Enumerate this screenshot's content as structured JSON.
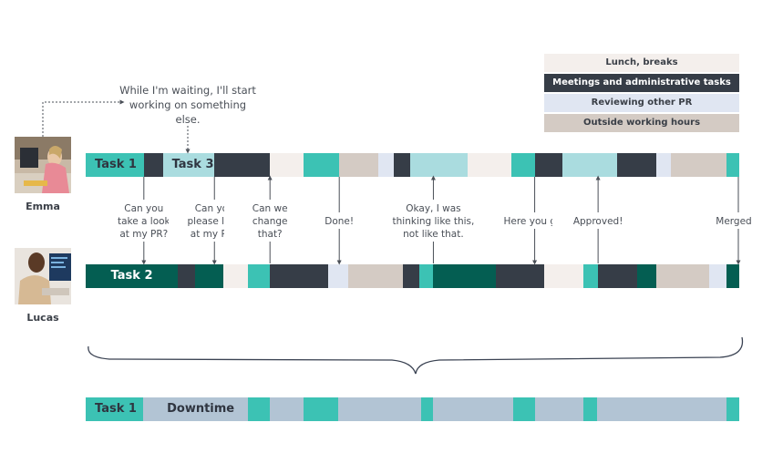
{
  "colors": {
    "teal": "#3cc2b4",
    "light_teal": "#aadcdf",
    "dark_green": "#045e52",
    "dark": "#363d47",
    "cream": "#f4efec",
    "light_blue": "#e0e6f2",
    "taupe": "#d4cbc4",
    "downtime_grey": "#b2c4d4",
    "line": "#4a4f57"
  },
  "legend": [
    {
      "label": "Lunch, breaks",
      "color": "#f4efec",
      "text_color": "#3a3f47"
    },
    {
      "label": "Meetings and administrative tasks",
      "color": "#363d47",
      "text_color": "#ffffff"
    },
    {
      "label": "Reviewing other PR",
      "color": "#e0e6f2",
      "text_color": "#3a3f47"
    },
    {
      "label": "Outside working hours",
      "color": "#d4cbc4",
      "text_color": "#3a3f47"
    }
  ],
  "people": {
    "emma": {
      "name": "Emma"
    },
    "lucas": {
      "name": "Lucas"
    }
  },
  "top_note": "While I'm waiting, I'll start working on something else.",
  "timeline_units": "relative time (0 = start, 100 = end)",
  "rows": {
    "emma": {
      "segments": [
        {
          "start": 0,
          "end": 8.9,
          "type": "teal",
          "label": "Task 1"
        },
        {
          "start": 8.9,
          "end": 11.8,
          "type": "dark"
        },
        {
          "start": 11.8,
          "end": 19.7,
          "type": "light_teal",
          "label": "Task 3"
        },
        {
          "start": 19.7,
          "end": 28.2,
          "type": "dark"
        },
        {
          "start": 28.2,
          "end": 33.4,
          "type": "cream"
        },
        {
          "start": 33.4,
          "end": 38.8,
          "type": "teal"
        },
        {
          "start": 38.8,
          "end": 44.8,
          "type": "taupe"
        },
        {
          "start": 44.8,
          "end": 47.2,
          "type": "light_blue"
        },
        {
          "start": 47.2,
          "end": 49.7,
          "type": "dark"
        },
        {
          "start": 49.7,
          "end": 58.5,
          "type": "light_teal"
        },
        {
          "start": 58.5,
          "end": 65.2,
          "type": "cream"
        },
        {
          "start": 65.2,
          "end": 68.7,
          "type": "teal"
        },
        {
          "start": 68.7,
          "end": 73.0,
          "type": "dark"
        },
        {
          "start": 73.0,
          "end": 81.3,
          "type": "light_teal"
        },
        {
          "start": 81.3,
          "end": 87.3,
          "type": "dark"
        },
        {
          "start": 87.3,
          "end": 89.6,
          "type": "light_blue"
        },
        {
          "start": 89.6,
          "end": 98.0,
          "type": "taupe"
        },
        {
          "start": 98.0,
          "end": 100,
          "type": "teal"
        }
      ]
    },
    "lucas": {
      "segments": [
        {
          "start": 0,
          "end": 14.1,
          "type": "dark_green",
          "label": "Task 2"
        },
        {
          "start": 14.1,
          "end": 16.7,
          "type": "dark"
        },
        {
          "start": 16.7,
          "end": 21.1,
          "type": "dark_green"
        },
        {
          "start": 21.1,
          "end": 24.8,
          "type": "cream"
        },
        {
          "start": 24.8,
          "end": 28.2,
          "type": "teal"
        },
        {
          "start": 28.2,
          "end": 37.1,
          "type": "dark"
        },
        {
          "start": 37.1,
          "end": 40.1,
          "type": "light_blue"
        },
        {
          "start": 40.1,
          "end": 48.6,
          "type": "taupe"
        },
        {
          "start": 48.6,
          "end": 51.1,
          "type": "dark"
        },
        {
          "start": 51.1,
          "end": 53.2,
          "type": "teal"
        },
        {
          "start": 53.2,
          "end": 62.7,
          "type": "dark_green"
        },
        {
          "start": 62.7,
          "end": 70.1,
          "type": "dark"
        },
        {
          "start": 70.1,
          "end": 76.1,
          "type": "cream"
        },
        {
          "start": 76.1,
          "end": 78.4,
          "type": "teal"
        },
        {
          "start": 78.4,
          "end": 84.4,
          "type": "dark"
        },
        {
          "start": 84.4,
          "end": 87.3,
          "type": "dark_green"
        },
        {
          "start": 87.3,
          "end": 95.4,
          "type": "taupe"
        },
        {
          "start": 95.4,
          "end": 98.0,
          "type": "light_blue"
        },
        {
          "start": 98.0,
          "end": 100,
          "type": "dark_green"
        }
      ]
    },
    "downtime": {
      "segments": [
        {
          "start": 0,
          "end": 8.8,
          "type": "teal",
          "label": "Task 1"
        },
        {
          "start": 8.8,
          "end": 24.8,
          "type": "downtime_grey",
          "label": "Downtime"
        },
        {
          "start": 24.8,
          "end": 28.2,
          "type": "teal"
        },
        {
          "start": 28.2,
          "end": 33.4,
          "type": "downtime_grey"
        },
        {
          "start": 33.4,
          "end": 38.7,
          "type": "teal"
        },
        {
          "start": 38.7,
          "end": 51.3,
          "type": "downtime_grey"
        },
        {
          "start": 51.3,
          "end": 53.2,
          "type": "teal"
        },
        {
          "start": 53.2,
          "end": 65.4,
          "type": "downtime_grey"
        },
        {
          "start": 65.4,
          "end": 68.7,
          "type": "teal"
        },
        {
          "start": 68.7,
          "end": 76.1,
          "type": "downtime_grey"
        },
        {
          "start": 76.1,
          "end": 78.2,
          "type": "teal"
        },
        {
          "start": 78.2,
          "end": 98.0,
          "type": "downtime_grey"
        },
        {
          "start": 98.0,
          "end": 100,
          "type": "teal"
        }
      ]
    }
  },
  "messages": [
    {
      "text": "Can you take a look at my PR?",
      "lines": [
        "Can you",
        "take a look",
        "at my PR?"
      ],
      "at": 8.9,
      "direction": "emma-to-lucas"
    },
    {
      "text": "Can you please look at my PR?",
      "lines": [
        "Can you",
        "please look",
        "at my PR?"
      ],
      "at": 19.7,
      "direction": "emma-to-lucas"
    },
    {
      "text": "Can we change that?",
      "lines": [
        "Can we",
        "change",
        "that?"
      ],
      "at": 28.2,
      "direction": "lucas-to-emma"
    },
    {
      "text": "Done!",
      "lines": [
        "Done!"
      ],
      "at": 38.8,
      "direction": "emma-to-lucas"
    },
    {
      "text": "Okay, I was thinking like this, not like that.",
      "lines": [
        "Okay, I was",
        "thinking like this,",
        "not like that."
      ],
      "at": 53.2,
      "direction": "lucas-to-emma"
    },
    {
      "text": "Here you go!",
      "lines": [
        "Here you go!"
      ],
      "at": 68.7,
      "direction": "emma-to-lucas"
    },
    {
      "text": "Approved!",
      "lines": [
        "Approved!"
      ],
      "at": 78.4,
      "direction": "lucas-to-emma"
    },
    {
      "text": "Merged",
      "lines": [
        "Merged"
      ],
      "at": 100,
      "direction": "emma-to-lucas"
    }
  ]
}
